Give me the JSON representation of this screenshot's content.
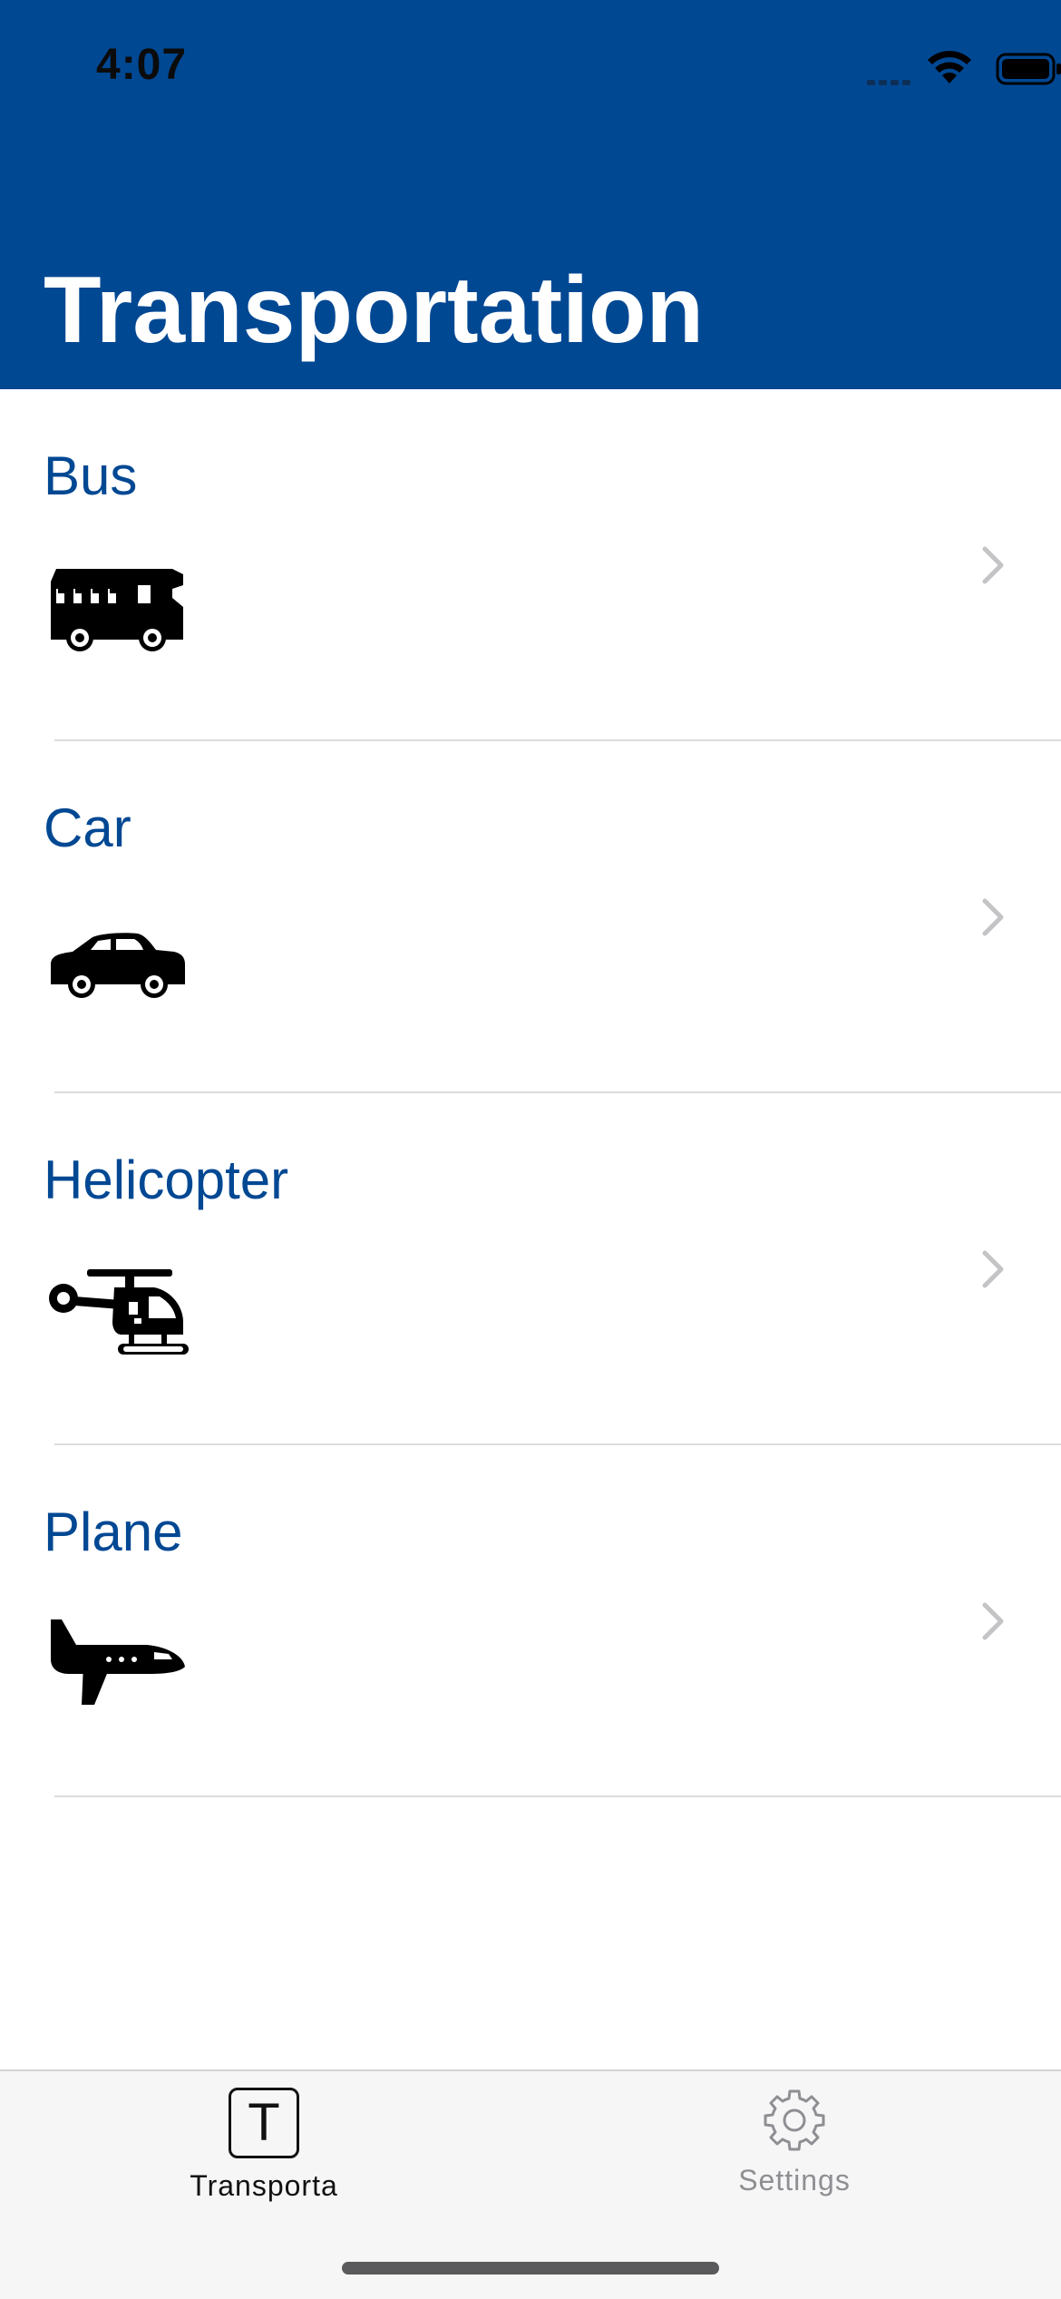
{
  "status_bar": {
    "time": "4:07"
  },
  "header": {
    "title": "Transportation",
    "color": "#014893"
  },
  "list": {
    "items": [
      {
        "label": "Bus",
        "icon": "bus-icon"
      },
      {
        "label": "Car",
        "icon": "car-icon"
      },
      {
        "label": "Helicopter",
        "icon": "helicopter-icon"
      },
      {
        "label": "Plane",
        "icon": "plane-icon"
      }
    ]
  },
  "tabbar": {
    "tabs": [
      {
        "label": "Transporta",
        "icon": "letter-t-icon",
        "glyph": "T",
        "selected": true
      },
      {
        "label": "Settings",
        "icon": "gear-icon",
        "selected": false
      }
    ]
  }
}
